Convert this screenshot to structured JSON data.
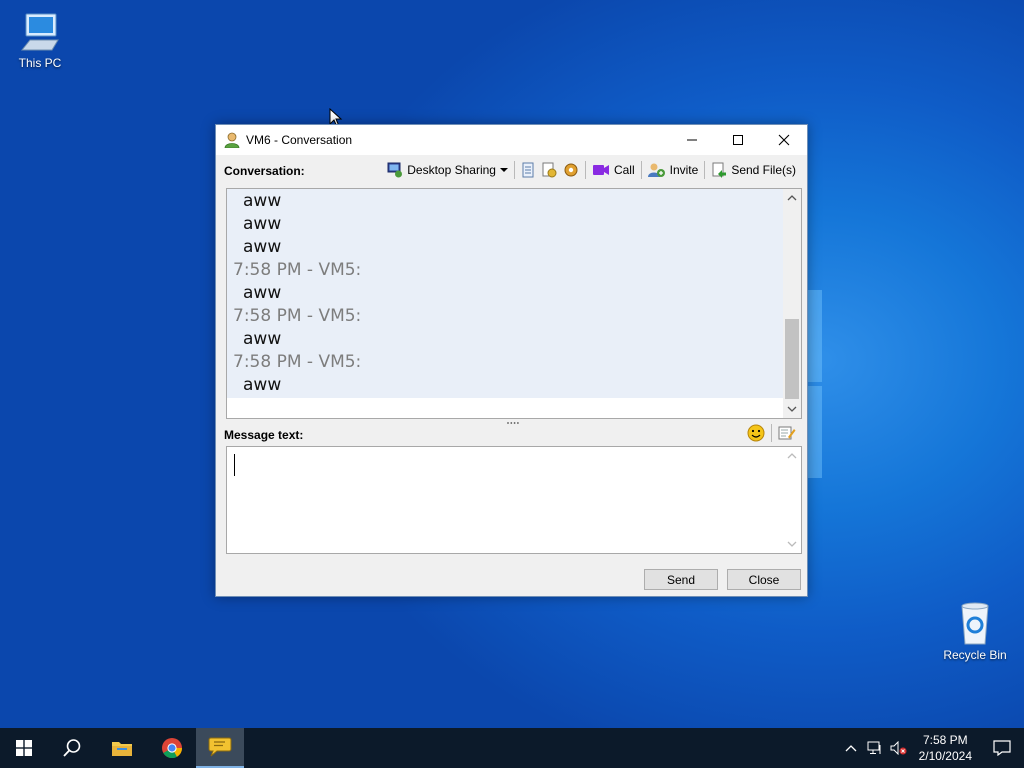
{
  "desktop": {
    "icons": [
      {
        "label": "This PC"
      },
      {
        "label": "Recycle Bin"
      }
    ]
  },
  "window": {
    "title": "VM6 - Conversation",
    "conversation_label": "Conversation:",
    "toolbar": {
      "desktop_sharing": "Desktop Sharing",
      "call": "Call",
      "invite": "Invite",
      "send_files": "Send File(s)"
    },
    "messages": [
      {
        "kind": "text",
        "text": "aww"
      },
      {
        "kind": "text",
        "text": "aww"
      },
      {
        "kind": "text",
        "text": "aww"
      },
      {
        "kind": "header",
        "text": "7:58 PM - VM5:"
      },
      {
        "kind": "text",
        "text": "aww"
      },
      {
        "kind": "header",
        "text": "7:58 PM - VM5:"
      },
      {
        "kind": "text",
        "text": "aww"
      },
      {
        "kind": "header",
        "text": "7:58 PM - VM5:"
      },
      {
        "kind": "text",
        "text": "aww"
      }
    ],
    "message_label": "Message text:",
    "message_value": "",
    "buttons": {
      "send": "Send",
      "close": "Close"
    }
  },
  "taskbar": {
    "clock_time": "7:58 PM",
    "clock_date": "2/10/2024"
  },
  "colors": {
    "accent": "#0f5cc7",
    "conv_bg": "#e9eff8",
    "header_text": "#7d7d7d"
  }
}
